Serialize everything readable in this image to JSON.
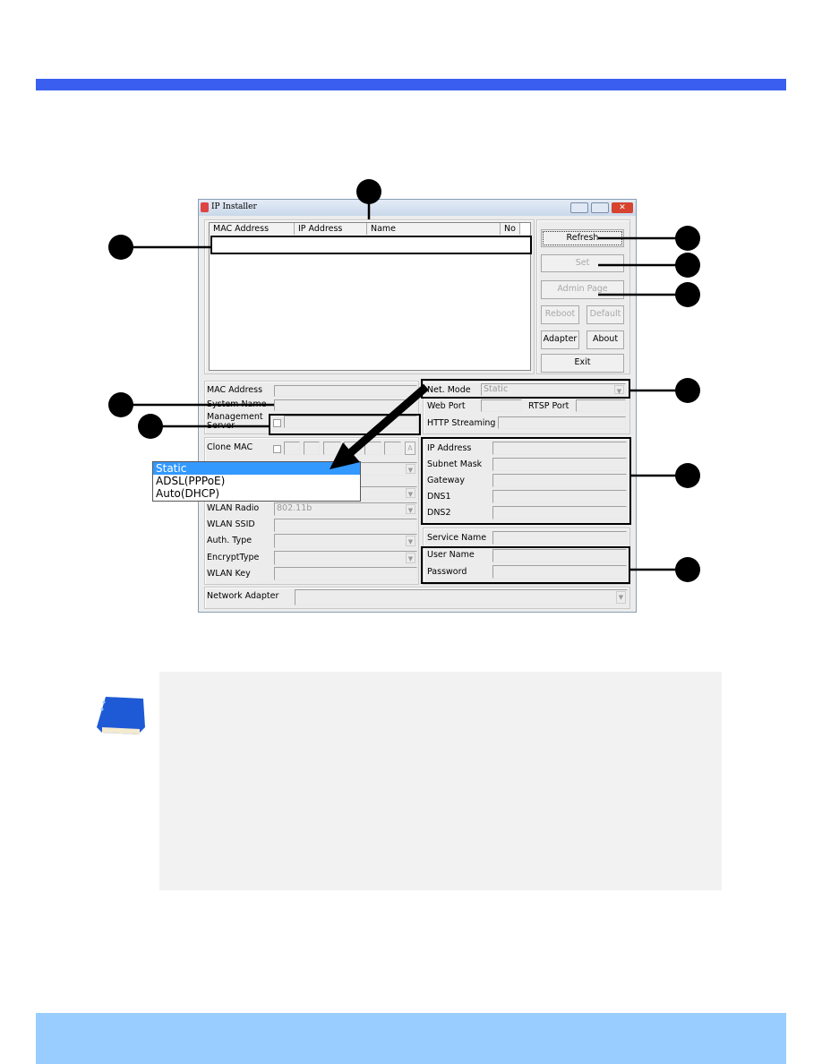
{
  "colors": {
    "top_bar": "#3a5ff0",
    "bottom_bar": "#99ccff",
    "note_bg": "#f2f2f2",
    "selection": "#3399ff"
  },
  "window": {
    "title": "IP Installer",
    "icons": [
      "app-icon",
      "minimize-icon",
      "maximize-icon",
      "close-icon"
    ]
  },
  "list": {
    "columns": [
      "MAC Address",
      "IP Address",
      "Name",
      "No"
    ]
  },
  "buttons": {
    "refresh": "Refresh",
    "set": "Set",
    "admin": "Admin Page",
    "reboot": "Reboot",
    "default": "Default",
    "adapter": "Adapter",
    "about": "About",
    "exit": "Exit"
  },
  "device": {
    "mac": "MAC Address",
    "system_name": "System Name",
    "mgmt1": "Management",
    "mgmt2": "Server"
  },
  "clone": {
    "label": "Clone MAC",
    "a_button": "A"
  },
  "wlan": {
    "radio": "WLAN Radio",
    "radio_value": "802.11b",
    "ssid": "WLAN SSID",
    "auth": "Auth. Type",
    "encrypt": "EncryptType",
    "key": "WLAN Key"
  },
  "net": {
    "mode": "Net. Mode",
    "mode_value": "Static",
    "web_port": "Web Port",
    "rtsp_port": "RTSP Port",
    "http": "HTTP Streaming"
  },
  "ip": {
    "rows": [
      "IP Address",
      "Subnet Mask",
      "Gateway",
      "DNS1",
      "DNS2"
    ]
  },
  "pppoe": {
    "service": "Service Name",
    "user": "User Name",
    "password": "Password"
  },
  "adapter": {
    "label": "Network Adapter"
  },
  "dropdown": {
    "options": [
      "Static",
      "ADSL(PPPoE)",
      "Auto(DHCP)"
    ],
    "selected": "Static"
  }
}
